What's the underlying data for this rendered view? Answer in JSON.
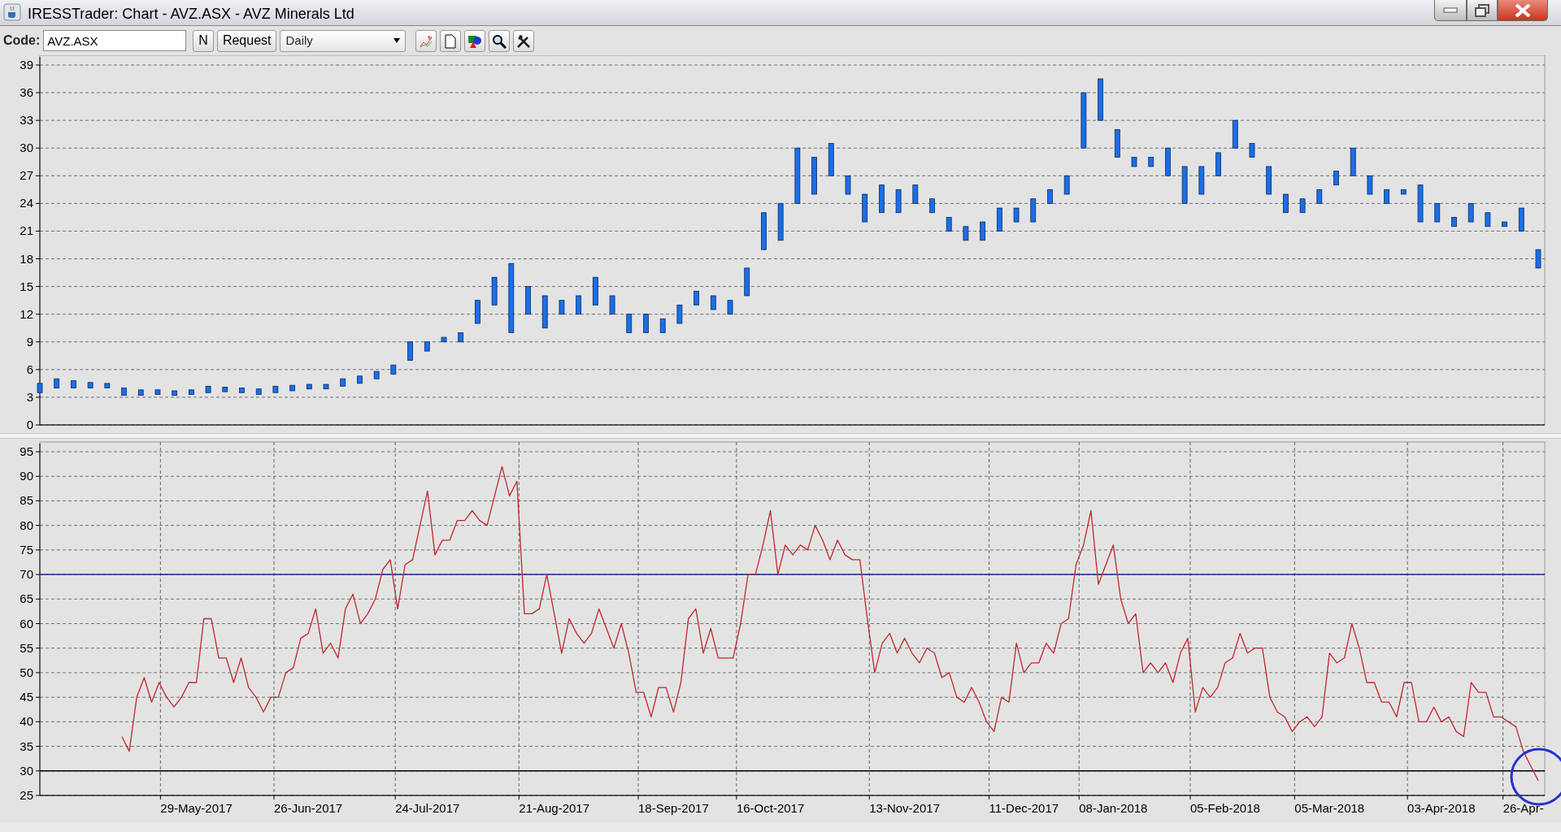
{
  "window": {
    "title": "IRESSTrader: Chart - AVZ.ASX - AVZ Minerals Ltd"
  },
  "toolbar": {
    "code_label": "Code:",
    "code_value": "AVZ.ASX",
    "buttons": [
      "N",
      "Request"
    ],
    "interval": "Daily"
  },
  "price_chart": {
    "chart_data": {
      "type": "candlestick",
      "grid": true,
      "ylim": [
        0,
        39
      ],
      "yticks": [
        0,
        3,
        6,
        9,
        12,
        15,
        18,
        21,
        24,
        27,
        30,
        33,
        36,
        39
      ],
      "categories": [
        null,
        null,
        null,
        null,
        null,
        null,
        null,
        null,
        null,
        null,
        null,
        null,
        null,
        null,
        null,
        null,
        null,
        null,
        null,
        null,
        null,
        null,
        null,
        null,
        null,
        null,
        null,
        null,
        null,
        null,
        null,
        null,
        null,
        null,
        null,
        null,
        null,
        null,
        null,
        null,
        null,
        null,
        null,
        null,
        null,
        null,
        null,
        null,
        null,
        null,
        null,
        null,
        null,
        null,
        null,
        null,
        null,
        null,
        null,
        null,
        null,
        null,
        null,
        null,
        null,
        null,
        null,
        null,
        null,
        null,
        null,
        null,
        null,
        null,
        null,
        null,
        null,
        null,
        null,
        null,
        null,
        null,
        null,
        null,
        null,
        null,
        null,
        null,
        null,
        null
      ],
      "ohlc": [
        [
          3.5,
          4.5,
          3.5,
          4.5
        ],
        [
          4,
          5,
          4,
          5
        ],
        [
          4,
          4.8,
          4,
          4.8
        ],
        [
          4,
          4.6,
          4,
          4.6
        ],
        [
          4,
          4.5,
          4,
          4.5
        ],
        [
          3.2,
          4,
          3.2,
          4
        ],
        [
          3.2,
          3.8,
          3.2,
          3.8
        ],
        [
          3.3,
          3.8,
          3.3,
          3.8
        ],
        [
          3.2,
          3.7,
          3.2,
          3.7
        ],
        [
          3.3,
          3.8,
          3.3,
          3.8
        ],
        [
          3.5,
          4.2,
          3.5,
          4.2
        ],
        [
          3.6,
          4.1,
          3.6,
          4.1
        ],
        [
          3.5,
          4,
          3.5,
          4
        ],
        [
          3.3,
          3.9,
          3.3,
          3.9
        ],
        [
          3.5,
          4.2,
          3.5,
          4.2
        ],
        [
          3.7,
          4.3,
          3.7,
          4.3
        ],
        [
          3.9,
          4.4,
          3.9,
          4.4
        ],
        [
          3.9,
          4.4,
          3.9,
          4.4
        ],
        [
          4.2,
          5,
          4.2,
          5
        ],
        [
          4.5,
          5.3,
          4.5,
          5.3
        ],
        [
          5,
          5.8,
          5,
          5.8
        ],
        [
          5.5,
          6.5,
          5.5,
          6.5
        ],
        [
          7,
          9,
          7,
          9
        ],
        [
          8,
          9,
          8,
          9
        ],
        [
          9,
          9.5,
          9,
          9.5
        ],
        [
          9,
          10,
          9,
          10
        ],
        [
          11,
          13.5,
          11,
          13.5
        ],
        [
          13,
          16,
          13,
          16
        ],
        [
          10,
          17.5,
          10,
          17.5
        ],
        [
          12,
          15,
          12,
          15
        ],
        [
          10.5,
          14,
          10.5,
          14
        ],
        [
          12,
          13.5,
          12,
          13.5
        ],
        [
          12,
          14,
          12,
          14
        ],
        [
          13,
          16,
          13,
          16
        ],
        [
          12,
          14,
          12,
          14
        ],
        [
          10,
          12,
          10,
          12
        ],
        [
          10,
          12,
          10,
          12
        ],
        [
          10,
          11.5,
          10,
          11.5
        ],
        [
          11,
          13,
          11,
          13
        ],
        [
          13,
          14.5,
          13,
          14.5
        ],
        [
          12.5,
          14,
          12.5,
          14
        ],
        [
          12,
          13.5,
          12,
          13.5
        ],
        [
          14,
          17,
          14,
          17
        ],
        [
          19,
          23,
          19,
          23
        ],
        [
          20,
          24,
          20,
          24
        ],
        [
          24,
          30,
          24,
          30
        ],
        [
          25,
          29,
          25,
          29
        ],
        [
          27,
          30.5,
          27,
          30.5
        ],
        [
          25,
          27,
          25,
          27
        ],
        [
          22,
          25,
          22,
          25
        ],
        [
          23,
          26,
          23,
          26
        ],
        [
          23,
          25.5,
          23,
          25.5
        ],
        [
          24,
          26,
          24,
          26
        ],
        [
          23,
          24.5,
          23,
          24.5
        ],
        [
          21,
          22.5,
          21,
          22.5
        ],
        [
          20,
          21.5,
          20,
          21.5
        ],
        [
          20,
          22,
          20,
          22
        ],
        [
          21,
          23.5,
          21,
          23.5
        ],
        [
          22,
          23.5,
          22,
          23.5
        ],
        [
          22,
          24.5,
          22,
          24.5
        ],
        [
          24,
          25.5,
          24,
          25.5
        ],
        [
          25,
          27,
          25,
          27
        ],
        [
          30,
          36,
          30,
          36
        ],
        [
          33,
          37.5,
          33,
          37.5
        ],
        [
          29,
          32,
          29,
          32
        ],
        [
          28,
          29,
          28,
          29
        ],
        [
          28,
          29,
          28,
          29
        ],
        [
          27,
          30,
          27,
          30
        ],
        [
          24,
          28,
          24,
          28
        ],
        [
          25,
          28,
          25,
          28
        ],
        [
          27,
          29.5,
          27,
          29.5
        ],
        [
          30,
          33,
          30,
          33
        ],
        [
          29,
          30.5,
          29,
          30.5
        ],
        [
          25,
          28,
          25,
          28
        ],
        [
          23,
          25,
          23,
          25
        ],
        [
          23,
          24.5,
          23,
          24.5
        ],
        [
          24,
          25.5,
          24,
          25.5
        ],
        [
          26,
          27.5,
          26,
          27.5
        ],
        [
          27,
          30,
          27,
          30
        ],
        [
          25,
          27,
          25,
          27
        ],
        [
          24,
          25.5,
          24,
          25.5
        ],
        [
          25,
          25.5,
          25,
          25.5
        ],
        [
          22,
          26,
          22,
          26
        ],
        [
          22,
          24,
          22,
          24
        ],
        [
          21.5,
          22.5,
          21.5,
          22.5
        ],
        [
          22,
          24,
          22,
          24
        ],
        [
          21.5,
          23,
          21.5,
          23
        ],
        [
          21.5,
          22,
          21.5,
          22
        ],
        [
          21,
          23.5,
          21,
          23.5
        ],
        [
          17,
          19,
          17,
          19
        ]
      ]
    }
  },
  "rsi_chart": {
    "chart_data": {
      "type": "line",
      "grid": true,
      "ylim": [
        25,
        95
      ],
      "yticks": [
        25,
        30,
        35,
        40,
        45,
        50,
        55,
        60,
        65,
        70,
        75,
        80,
        85,
        90,
        95
      ],
      "categories": [
        null,
        null,
        null,
        null,
        null,
        null,
        null,
        null,
        null,
        null,
        null,
        null,
        null,
        null,
        null,
        null,
        null,
        null,
        null,
        null,
        null,
        "29-May-2017",
        null,
        null,
        null,
        null,
        null,
        null,
        null,
        null,
        null,
        null,
        null,
        null,
        null,
        null,
        "26-Jun-2017",
        null,
        null,
        null,
        null,
        null,
        null,
        null,
        null,
        null,
        null,
        null,
        null,
        null,
        null,
        null,
        "24-Jul-2017",
        null,
        null,
        null,
        null,
        null,
        null,
        null,
        null,
        null,
        null,
        null,
        null,
        null,
        null,
        null,
        null,
        "21-Aug-2017",
        null,
        null,
        null,
        null,
        null,
        null,
        null,
        null,
        null,
        null,
        null,
        null,
        null,
        null,
        null,
        "18-Sep-2017",
        null,
        null,
        null,
        null,
        null,
        null,
        null,
        null,
        null,
        null,
        null,
        null,
        "16-Oct-2017",
        null,
        null,
        null,
        null,
        null,
        null,
        null,
        null,
        null,
        null,
        null,
        null,
        null,
        null,
        null,
        null,
        null,
        "13-Nov-2017",
        null,
        null,
        null,
        null,
        null,
        null,
        null,
        null,
        null,
        null,
        null,
        null,
        null,
        null,
        null,
        "11-Dec-2017",
        null,
        null,
        null,
        null,
        null,
        null,
        null,
        null,
        null,
        null,
        null,
        "08-Jan-2018",
        null,
        null,
        null,
        null,
        null,
        null,
        null,
        null,
        null,
        null,
        null,
        null,
        null,
        null,
        "05-Feb-2018",
        null,
        null,
        null,
        null,
        null,
        null,
        null,
        null,
        null,
        null,
        null,
        null,
        null,
        "05-Mar-2018",
        null,
        null,
        null,
        null,
        null,
        null,
        null,
        null,
        null,
        null,
        null,
        null,
        null,
        null,
        "03-Apr-2018",
        null,
        null,
        null,
        null,
        null,
        null,
        null,
        null,
        null,
        null,
        "26-Apr-",
        null,
        null
      ],
      "series": [
        {
          "color": "#c0282d",
          "values": [
            null,
            null,
            null,
            null,
            null,
            null,
            null,
            null,
            null,
            null,
            null,
            37,
            34,
            45,
            49,
            44,
            48,
            45,
            43,
            45,
            48,
            48,
            61,
            61,
            53,
            53,
            48,
            53,
            47,
            45,
            42,
            45,
            45,
            50,
            51,
            57,
            58,
            63,
            54,
            56,
            53,
            63,
            66,
            60,
            62,
            65,
            71,
            73,
            63,
            72,
            73,
            80,
            87,
            74,
            77,
            77,
            81,
            81,
            83,
            81,
            80,
            86,
            92,
            86,
            89,
            62,
            62,
            63,
            70,
            62,
            54,
            61,
            58,
            56,
            58,
            63,
            59,
            55,
            60,
            54,
            46,
            46,
            41,
            47,
            47,
            42,
            48,
            61,
            63,
            54,
            59,
            53,
            53,
            53,
            60,
            70,
            70,
            76,
            83,
            70,
            76,
            74,
            76,
            75,
            80,
            77,
            73,
            77,
            74,
            73,
            73,
            61,
            50,
            56,
            58,
            54,
            57,
            54,
            52,
            55,
            54,
            49,
            50,
            45,
            44,
            47,
            44,
            40,
            38,
            45,
            44,
            56,
            50,
            52,
            52,
            56,
            54,
            60,
            61,
            72,
            76,
            83,
            68,
            72,
            76,
            65,
            60,
            62,
            50,
            52,
            50,
            52,
            48,
            54,
            57,
            42,
            47,
            45,
            47,
            52,
            53,
            58,
            54,
            55,
            55,
            45,
            42,
            41,
            38,
            40,
            41,
            39,
            41,
            54,
            52,
            53,
            60,
            55,
            48,
            48,
            44,
            44,
            41,
            48,
            48,
            40,
            40,
            43,
            40,
            41,
            38,
            37,
            48,
            46,
            46,
            41,
            41,
            40,
            39,
            34,
            31,
            28
          ]
        }
      ],
      "ref_lines": [
        {
          "axis": "y",
          "value": 70
        },
        {
          "axis": "y",
          "value": 30
        }
      ]
    }
  }
}
